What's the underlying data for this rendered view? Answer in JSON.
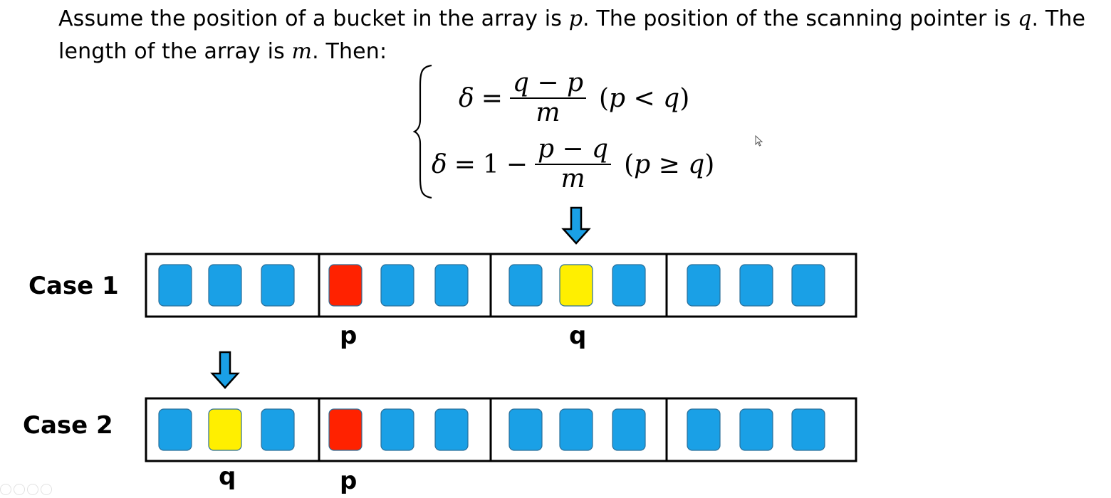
{
  "intro": {
    "t1": "Assume the position of a bucket in the array is ",
    "v1": "p",
    "t2": ". The position of the scanning pointer is ",
    "v2": "q",
    "t3": ". The length of the array is ",
    "v3": "m",
    "t4": ". Then:"
  },
  "formula": {
    "line1": {
      "lhs": "δ",
      "eq": "=",
      "num": "q − p",
      "den": "m",
      "cond_open": "(",
      "cond_p": "p",
      "cond_op": "<",
      "cond_q": "q",
      "cond_close": ")"
    },
    "line2": {
      "lhs": "δ",
      "eq": "=",
      "one": "1",
      "minus": "−",
      "num": "p − q",
      "den": "m",
      "cond_open": "(",
      "cond_p": "p",
      "cond_op": "≥",
      "cond_q": "q",
      "cond_close": ")"
    }
  },
  "cases": [
    {
      "label": "Case 1",
      "cells": [
        "blue",
        "blue",
        "blue",
        "red",
        "blue",
        "blue",
        "blue",
        "yellow",
        "blue",
        "blue",
        "blue",
        "blue"
      ],
      "p_label": "p",
      "q_label": "q",
      "arrow_cell": 7
    },
    {
      "label": "Case 2",
      "cells": [
        "blue",
        "yellow",
        "blue",
        "red",
        "blue",
        "blue",
        "blue",
        "blue",
        "blue",
        "blue",
        "blue",
        "blue"
      ],
      "p_label": "p",
      "q_label": "q",
      "arrow_cell": 1
    }
  ],
  "colors": {
    "blue": "#1aa0e6",
    "red": "#ff2200",
    "yellow": "#ffef00",
    "arrow": "#1aa0e6",
    "frame": "#000000"
  },
  "icons": [
    "down-arrow-icon",
    "cursor-icon"
  ]
}
